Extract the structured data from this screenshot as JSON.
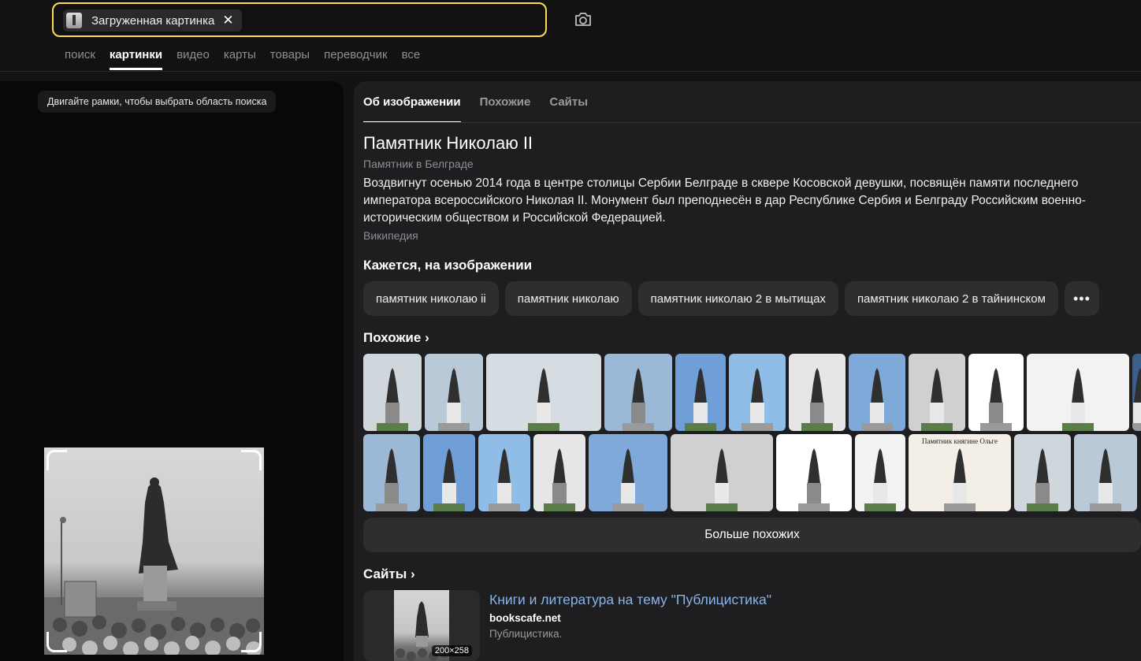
{
  "search": {
    "chip_label": "Загруженная картинка",
    "close_glyph": "✕",
    "camera_icon": "camera-search-icon"
  },
  "nav": {
    "items": [
      "поиск",
      "картинки",
      "видео",
      "карты",
      "товары",
      "переводчик",
      "все"
    ],
    "active_index": 1
  },
  "left": {
    "hint": "Двигайте рамки, чтобы выбрать область поиска"
  },
  "tabs": {
    "items": [
      "Об изображении",
      "Похожие",
      "Сайты"
    ],
    "active_index": 0
  },
  "about": {
    "title": "Памятник Николаю II",
    "subtitle": "Памятник в Белграде",
    "description": "Воздвигнут осенью 2014 года в центре столицы Сербии Белграде в сквере Косовской девушки, посвящён памяти последнего императора всероссийского Николая II. Монумент был преподнесён в дар Республике Сербия и Белграду Российским военно-историческим обществом и Российской Федерацией.",
    "source": "Википедия"
  },
  "seems": {
    "heading": "Кажется, на изображении",
    "tags": [
      "памятник николаю ii",
      "памятник николаю",
      "памятник николаю 2 в мытищах",
      "памятник николаю 2 в тайнинском"
    ],
    "more_glyph": "•••"
  },
  "similar": {
    "heading": "Похожие",
    "chevron": "›",
    "more_button": "Больше похожих",
    "embedded_caption": "Памятник княгине Ольге"
  },
  "sites": {
    "heading": "Сайты",
    "chevron": "›",
    "item": {
      "title": "Книги и литература на тему \"Публицистика\"",
      "domain": "bookscafe.net",
      "snippet": "Публицистика.",
      "size": "200×258"
    }
  },
  "colors": {
    "accent": "#ffdb4d",
    "link": "#8ab4e8",
    "panel": "#1e1e20",
    "chip": "#2e2e31"
  }
}
